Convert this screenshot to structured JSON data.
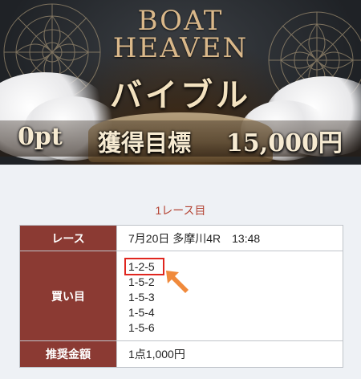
{
  "hero": {
    "title_line1": "BOAT",
    "title_line2": "HEAVEN",
    "subtitle": "バイブル",
    "points": "0pt",
    "goal_label": "獲得目標",
    "goal_amount": "15,000円"
  },
  "race_section": {
    "heading": "1レース目",
    "rows": {
      "race": {
        "label": "レース",
        "value": "7月20日 多摩川4R　13:48"
      },
      "buy": {
        "label": "買い目",
        "items": [
          "1-2-5",
          "1-5-2",
          "1-5-3",
          "1-5-4",
          "1-5-6"
        ]
      },
      "amount": {
        "label": "推奨金額",
        "value": "1点1,000円"
      }
    }
  },
  "colors": {
    "header_cell": "#8b3a33",
    "heading_text": "#b44434",
    "highlight": "#e0261f",
    "arrow": "#f08a3c"
  }
}
